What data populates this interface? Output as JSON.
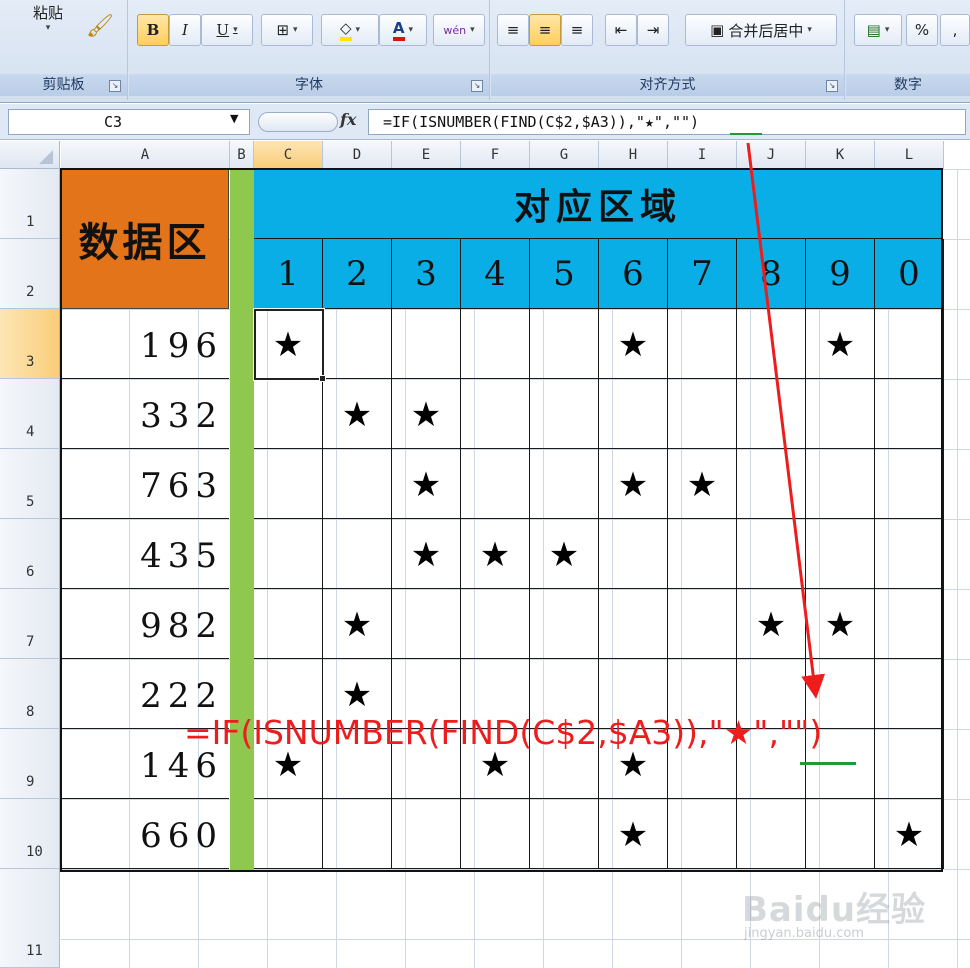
{
  "ribbon": {
    "clipboard": {
      "paste_label": "粘贴",
      "group_label": "剪贴板"
    },
    "font": {
      "bold": "B",
      "italic": "I",
      "underline": "U",
      "group_label": "字体",
      "phonetic": "wén"
    },
    "alignment": {
      "merge_label": "合并后居中",
      "group_label": "对齐方式"
    },
    "number": {
      "percent": "%",
      "comma": ",",
      "group_label": "数字"
    }
  },
  "formula_bar": {
    "name_box": "C3",
    "fx": "fx",
    "formula": "=IF(ISNUMBER(FIND(C$2,$A3)),\"★\",\"\")"
  },
  "columns": [
    "A",
    "B",
    "C",
    "D",
    "E",
    "F",
    "G",
    "H",
    "I",
    "J",
    "K",
    "L"
  ],
  "rows": [
    "1",
    "2",
    "3",
    "4",
    "5",
    "6",
    "7",
    "8",
    "9",
    "10",
    "11"
  ],
  "sheet": {
    "data_header": "数据区",
    "region_header": "对应区域",
    "digits": [
      "1",
      "2",
      "3",
      "4",
      "5",
      "6",
      "7",
      "8",
      "9",
      "0"
    ],
    "numbers": [
      "196",
      "332",
      "763",
      "435",
      "982",
      "222",
      "146",
      "660"
    ],
    "star": "★",
    "stars": [
      [
        "★",
        "",
        "",
        "",
        "",
        "★",
        "",
        "",
        "★",
        ""
      ],
      [
        "",
        "★",
        "★",
        "",
        "",
        "",
        "",
        "",
        "",
        ""
      ],
      [
        "",
        "",
        "★",
        "",
        "",
        "★",
        "★",
        "",
        "",
        ""
      ],
      [
        "",
        "",
        "★",
        "★",
        "★",
        "",
        "",
        "",
        "",
        ""
      ],
      [
        "",
        "★",
        "",
        "",
        "",
        "",
        "",
        "★",
        "★",
        ""
      ],
      [
        "",
        "★",
        "",
        "",
        "",
        "",
        "",
        "",
        "",
        ""
      ],
      [
        "★",
        "",
        "",
        "★",
        "",
        "★",
        "",
        "",
        "",
        ""
      ],
      [
        "",
        "",
        "",
        "",
        "",
        "★",
        "",
        "",
        "",
        "★"
      ]
    ]
  },
  "annotation": {
    "formula": "=IF(ISNUMBER(FIND(C$2,$A3)),\"★\",\"\")",
    "color": "#ee1c1c"
  },
  "watermark": {
    "main": "Baidu经验",
    "sub": "jingyan.baidu.com"
  }
}
